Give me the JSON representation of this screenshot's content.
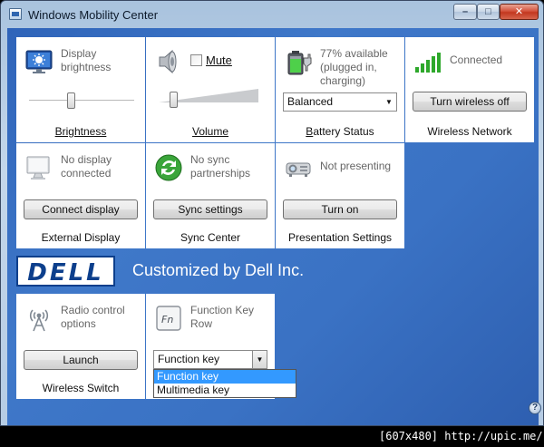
{
  "window": {
    "title": "Windows Mobility Center",
    "minimize_glyph": "–",
    "maximize_glyph": "□",
    "close_glyph": "✕"
  },
  "tiles": {
    "brightness": {
      "desc": "Display brightness",
      "label": "Brightness",
      "level": 0.4
    },
    "volume": {
      "mute_label": "Mute",
      "label": "Volume",
      "muted": false,
      "level": 0.1
    },
    "battery": {
      "desc": "77% available (plugged in, charging)",
      "select_value": "Balanced",
      "label": "Battery Status",
      "percent": 77
    },
    "wireless": {
      "desc": "Connected",
      "button": "Turn wireless off",
      "label": "Wireless Network"
    },
    "external_display": {
      "desc": "No display connected",
      "button": "Connect display",
      "label": "External Display"
    },
    "sync": {
      "desc": "No sync partnerships",
      "button": "Sync settings",
      "label": "Sync Center"
    },
    "presentation": {
      "desc": "Not presenting",
      "button": "Turn on",
      "label": "Presentation Settings"
    },
    "radio": {
      "desc": "Radio control options",
      "button": "Launch",
      "label": "Wireless Switch"
    },
    "function_key": {
      "desc": "Function Key Row",
      "select_value": "Function key",
      "options": [
        "Function key",
        "Multimedia key"
      ],
      "selected_index": 0
    }
  },
  "dell": {
    "logo": "DELL",
    "text": "Customized by Dell Inc."
  },
  "help": {
    "glyph": "?"
  },
  "watermark": "[607x480] http://upic.me/",
  "colors": {
    "client_background": "#3a72c4",
    "tile_background": "#ffffff",
    "dell_blue": "#0d3f8c",
    "selection": "#3399ff"
  }
}
